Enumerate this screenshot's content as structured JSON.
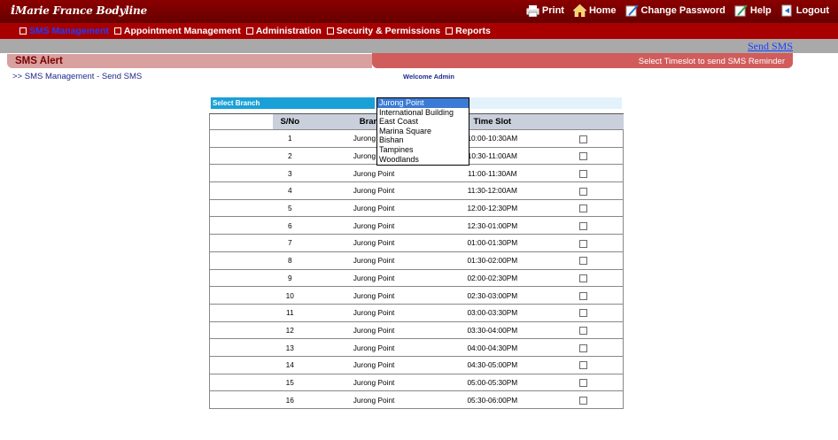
{
  "header": {
    "logo": "Marie France Bodyline",
    "links": [
      {
        "label": "Print",
        "icon": "printer-icon"
      },
      {
        "label": "Home",
        "icon": "home-icon"
      },
      {
        "label": "Change Password",
        "icon": "edit-password-icon"
      },
      {
        "label": "Help",
        "icon": "help-icon"
      },
      {
        "label": "Logout",
        "icon": "logout-icon"
      }
    ]
  },
  "nav": [
    {
      "label": "SMS Management",
      "active": true
    },
    {
      "label": "Appointment Management",
      "active": false
    },
    {
      "label": "Administration",
      "active": false
    },
    {
      "label": "Security & Permissions",
      "active": false
    },
    {
      "label": "Reports",
      "active": false
    }
  ],
  "send_sms_link": "Send SMS",
  "alert": {
    "title": "SMS Alert",
    "hint": "Select Timeslot to send SMS Reminder"
  },
  "breadcrumb": ">>  SMS Management - Send SMS",
  "welcome": "Welcome Admin",
  "branch_label": "Select Branch",
  "branch_dropdown": {
    "selected": "Jurong Point",
    "options": [
      "Jurong Point",
      "International Building",
      "East Coast",
      "Marina Square",
      "Bishan",
      "Tampines",
      "Woodlands"
    ]
  },
  "table": {
    "headers": [
      "S/No",
      "Branch",
      "Time Slot"
    ],
    "rows": [
      {
        "sno": "1",
        "branch": "Jurong Point",
        "slot": "10:00-10:30AM"
      },
      {
        "sno": "2",
        "branch": "Jurong Point",
        "slot": "10:30-11:00AM"
      },
      {
        "sno": "3",
        "branch": "Jurong Point",
        "slot": "11:00-11:30AM"
      },
      {
        "sno": "4",
        "branch": "Jurong Point",
        "slot": "11:30-12:00AM"
      },
      {
        "sno": "5",
        "branch": "Jurong Point",
        "slot": "12:00-12:30PM"
      },
      {
        "sno": "6",
        "branch": "Jurong Point",
        "slot": "12:30-01:00PM"
      },
      {
        "sno": "7",
        "branch": "Jurong Point",
        "slot": "01:00-01:30PM"
      },
      {
        "sno": "8",
        "branch": "Jurong Point",
        "slot": "01:30-02:00PM"
      },
      {
        "sno": "9",
        "branch": "Jurong Point",
        "slot": "02:00-02:30PM"
      },
      {
        "sno": "10",
        "branch": "Jurong Point",
        "slot": "02:30-03:00PM"
      },
      {
        "sno": "11",
        "branch": "Jurong Point",
        "slot": "03:00-03:30PM"
      },
      {
        "sno": "12",
        "branch": "Jurong Point",
        "slot": "03:30-04:00PM"
      },
      {
        "sno": "13",
        "branch": "Jurong Point",
        "slot": "04:00-04:30PM"
      },
      {
        "sno": "14",
        "branch": "Jurong Point",
        "slot": "04:30-05:00PM"
      },
      {
        "sno": "15",
        "branch": "Jurong Point",
        "slot": "05:00-05:30PM"
      },
      {
        "sno": "16",
        "branch": "Jurong Point",
        "slot": "05:30-06:00PM"
      }
    ]
  },
  "colors": {
    "header_dark_red": "#8b0000",
    "nav_red": "#a80000",
    "active_nav_blue": "#1f3cff",
    "branch_label_blue": "#1aa0d6",
    "alert_pink": "#d15c5c"
  }
}
